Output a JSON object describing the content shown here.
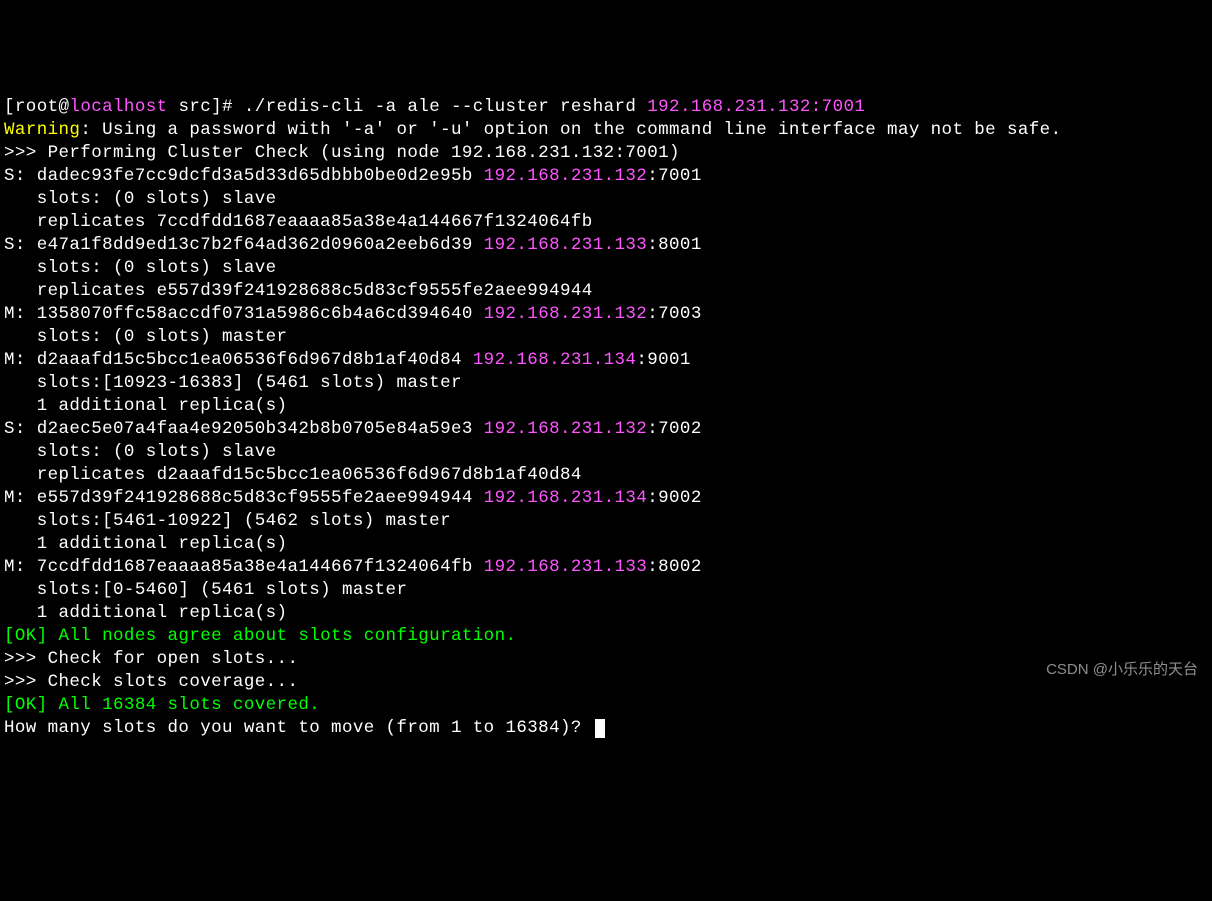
{
  "prompt": {
    "prefix": "[root@",
    "host": "localhost",
    "suffix": " src]# ",
    "command": "./redis-cli -a ale --cluster reshard ",
    "target": "192.168.231.132:7001"
  },
  "warning": {
    "label": "Warning",
    "msg": ": Using a password with '-a' or '-u' option on the command line interface may not be safe."
  },
  "header": ">>> Performing Cluster Check (using node 192.168.231.132:7001)",
  "nodes": [
    {
      "role": "S:",
      "id": "dadec93fe7cc9dcfd3a5d33d65dbbb0be0d2e95b",
      "ip": "192.168.231.132",
      "port": ":7001",
      "lines": [
        "   slots: (0 slots) slave",
        "   replicates 7ccdfdd1687eaaaa85a38e4a144667f1324064fb"
      ]
    },
    {
      "role": "S:",
      "id": "e47a1f8dd9ed13c7b2f64ad362d0960a2eeb6d39",
      "ip": "192.168.231.133",
      "port": ":8001",
      "lines": [
        "   slots: (0 slots) slave",
        "   replicates e557d39f241928688c5d83cf9555fe2aee994944"
      ]
    },
    {
      "role": "M:",
      "id": "1358070ffc58accdf0731a5986c6b4a6cd394640",
      "ip": "192.168.231.132",
      "port": ":7003",
      "lines": [
        "   slots: (0 slots) master"
      ]
    },
    {
      "role": "M:",
      "id": "d2aaafd15c5bcc1ea06536f6d967d8b1af40d84",
      "ip": "192.168.231.134",
      "port": ":9001",
      "lines": [
        "   slots:[10923-16383] (5461 slots) master",
        "   1 additional replica(s)"
      ]
    },
    {
      "role": "S:",
      "id": "d2aec5e07a4faa4e92050b342b8b0705e84a59e3",
      "ip": "192.168.231.132",
      "port": ":7002",
      "lines": [
        "   slots: (0 slots) slave",
        "   replicates d2aaafd15c5bcc1ea06536f6d967d8b1af40d84"
      ]
    },
    {
      "role": "M:",
      "id": "e557d39f241928688c5d83cf9555fe2aee994944",
      "ip": "192.168.231.134",
      "port": ":9002",
      "lines": [
        "   slots:[5461-10922] (5462 slots) master",
        "   1 additional replica(s)"
      ]
    },
    {
      "role": "M:",
      "id": "7ccdfdd1687eaaaa85a38e4a144667f1324064fb",
      "ip": "192.168.231.133",
      "port": ":8002",
      "lines": [
        "   slots:[0-5460] (5461 slots) master",
        "   1 additional replica(s)"
      ]
    }
  ],
  "ok1": "[OK] All nodes agree about slots configuration.",
  "check1": ">>> Check for open slots...",
  "check2": ">>> Check slots coverage...",
  "ok2": "[OK] All 16384 slots covered.",
  "question": "How many slots do you want to move (from 1 to 16384)? ",
  "watermark": "CSDN @小乐乐的天台"
}
